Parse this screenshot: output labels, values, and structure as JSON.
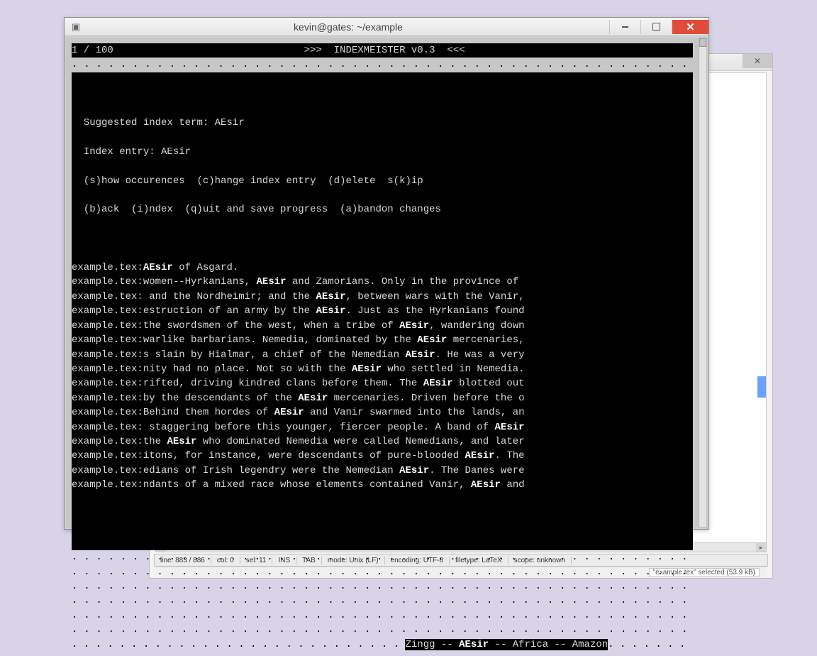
{
  "terminal": {
    "title": "kevin@gates: ~/example",
    "counter": "1 / 100",
    "header": ">>>  INDEXMEISTER v0.3  <<<",
    "suggested_label": "Suggested index term: AEsir",
    "index_entry_label": "Index entry: AEsir",
    "actions_line1": "(s)how occurences  (c)hange index entry  (d)elete  s(k)ip",
    "actions_line2": "(b)ack  (i)ndex  (q)uit and save progress  (a)bandon changes",
    "file_prefix": "example.tex:",
    "hits": [
      {
        "pre": "",
        "kw": "AEsir",
        "post": " of Asgard."
      },
      {
        "pre": "women--Hyrkanians, ",
        "kw": "AEsir",
        "post": " and Zamorians. Only in the province of"
      },
      {
        "pre": " and the Nordheimir; and the ",
        "kw": "AEsir",
        "post": ", between wars with the Vanir,"
      },
      {
        "pre": "estruction of an army by the ",
        "kw": "AEsir",
        "post": ". Just as the Hyrkanians found"
      },
      {
        "pre": "the swordsmen of the west, when a tribe of ",
        "kw": "AEsir",
        "post": ", wandering down"
      },
      {
        "pre": "warlike barbarians. Nemedia, dominated by the ",
        "kw": "AEsir",
        "post": " mercenaries,"
      },
      {
        "pre": "s slain by Hialmar, a chief of the Nemedian ",
        "kw": "AEsir",
        "post": ". He was a very"
      },
      {
        "pre": "nity had no place. Not so with the ",
        "kw": "AEsir",
        "post": " who settled in Nemedia."
      },
      {
        "pre": "rifted, driving kindred clans before them. The ",
        "kw": "AEsir",
        "post": " blotted out"
      },
      {
        "pre": "by the descendants of the ",
        "kw": "AEsir",
        "post": " mercenaries. Driven before the o"
      },
      {
        "pre": "Behind them hordes of ",
        "kw": "AEsir",
        "post": " and Vanir swarmed into the lands, an"
      },
      {
        "pre": " staggering before this younger, fiercer people. A band of ",
        "kw": "AEsir",
        "post": ""
      },
      {
        "pre": "the ",
        "kw": "AEsir",
        "post": " who dominated Nemedia were called Nemedians, and later"
      },
      {
        "pre": "itons, for instance, were descendants of pure-blooded ",
        "kw": "AEsir",
        "post": ". The"
      },
      {
        "pre": "edians of Irish legendry were the Nemedian ",
        "kw": "AEsir",
        "post": ". The Danes were"
      },
      {
        "pre": "ndants of a mixed race whose elements contained Vanir, ",
        "kw": "AEsir",
        "post": " and"
      }
    ],
    "nav_prev": "Zingg",
    "nav_current": "AEsir",
    "nav_next1": "Africa",
    "nav_next2": "Amazon"
  },
  "editor": {
    "status": {
      "line": "line: 883 / 886",
      "col": "col: 0",
      "sel": "sel: 11",
      "ins": "INS",
      "tab": "TAB",
      "mode": "mode: Unix (LF)",
      "encoding": "encoding: UTF-8",
      "filetype": "filetype: LaTeX",
      "scope": "scope: unknown"
    },
    "footer_left": "",
    "footer_selected": "\"example.tex\" selected  (53.9 kB)"
  }
}
